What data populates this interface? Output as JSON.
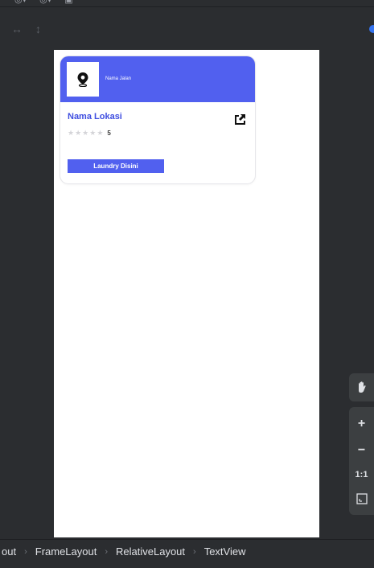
{
  "editor": {
    "top_toolbar": {
      "icons": [
        "device-icon",
        "theme-icon",
        "api-icon"
      ]
    },
    "sub_toolbar": {
      "icons": [
        "horizontal-resize-icon",
        "vertical-resize-icon"
      ]
    }
  },
  "preview": {
    "card": {
      "street": "Nama Jalan",
      "location_name": "Nama Lokasi",
      "stars_total": 5,
      "stars_filled": 0,
      "rating": "5",
      "button_label": "Laundry Disini"
    }
  },
  "zoom_controls": {
    "zoom_in": "+",
    "zoom_out": "−",
    "actual_size": "1:1"
  },
  "breadcrumb": {
    "items": [
      "out",
      "FrameLayout",
      "RelativeLayout",
      "TextView"
    ]
  },
  "colors": {
    "accent": "#5160ef",
    "ide_background": "#2b2d30",
    "panel": "#3c3f41"
  }
}
